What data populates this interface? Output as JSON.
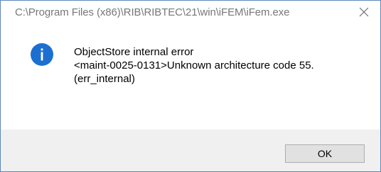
{
  "window": {
    "title": "C:\\Program Files (x86)\\RIB\\RIBTEC\\21\\win\\iFEM\\iFem.exe",
    "close_icon": "close-icon"
  },
  "message": {
    "icon": "info-icon",
    "lines": [
      "ObjectStore internal error",
      "<maint-0025-0131>Unknown architecture code 55.",
      "(err_internal)"
    ]
  },
  "buttons": {
    "ok_label": "OK"
  },
  "colors": {
    "icon_blue": "#1c6fd1",
    "footer_bg": "#f0f0f0",
    "border": "#5d87ba"
  }
}
